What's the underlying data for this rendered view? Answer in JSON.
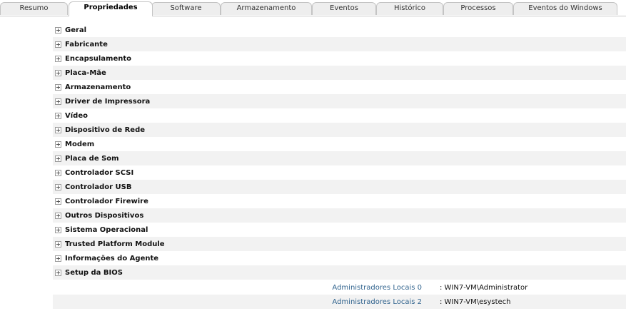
{
  "tabs": [
    {
      "label": "Resumo",
      "active": false
    },
    {
      "label": "Propriedades",
      "active": true
    },
    {
      "label": "Software",
      "active": false
    },
    {
      "label": "Armazenamento",
      "active": false
    },
    {
      "label": "Eventos",
      "active": false
    },
    {
      "label": "Histórico",
      "active": false
    },
    {
      "label": "Processos",
      "active": false
    },
    {
      "label": "Eventos do Windows",
      "active": false
    }
  ],
  "tree": {
    "expander_icon": "plus-box-icon",
    "items": [
      {
        "label": "Geral"
      },
      {
        "label": "Fabricante"
      },
      {
        "label": "Encapsulamento"
      },
      {
        "label": "Placa-Mãe"
      },
      {
        "label": "Armazenamento"
      },
      {
        "label": "Driver de Impressora"
      },
      {
        "label": "Vídeo"
      },
      {
        "label": "Dispositivo de Rede"
      },
      {
        "label": "Modem"
      },
      {
        "label": "Placa de Som"
      },
      {
        "label": "Controlador SCSI"
      },
      {
        "label": "Controlador USB"
      },
      {
        "label": "Controlador Firewire"
      },
      {
        "label": "Outros Dispositivos"
      },
      {
        "label": "Sistema Operacional"
      },
      {
        "label": "Trusted Platform Module"
      },
      {
        "label": "Informações do Agente"
      },
      {
        "label": "Setup da BIOS"
      }
    ]
  },
  "properties": [
    {
      "key": "Administradores Locais 0",
      "value": ": WIN7-VM\\Administrator"
    },
    {
      "key": "Administradores Locais 2",
      "value": ": WIN7-VM\\esystech"
    }
  ],
  "colors": {
    "link_key": "#33658f",
    "row_alt": "#f2f2f2",
    "tab_bg": "#eeeeee"
  }
}
